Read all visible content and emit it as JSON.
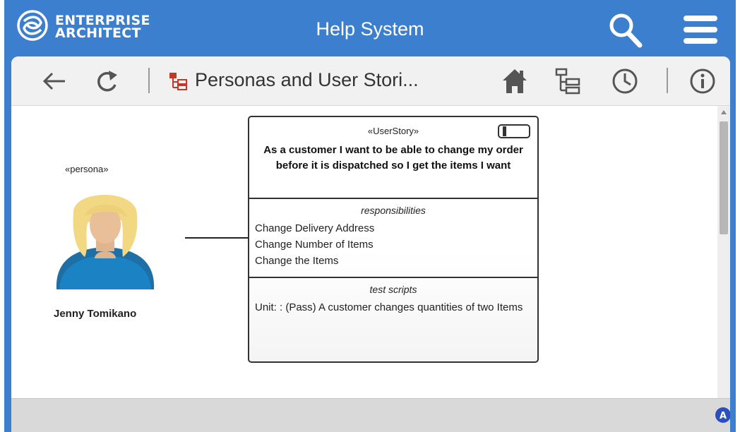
{
  "window": {
    "logo": {
      "icon": "enterprise-architect-logo",
      "line1": "ENTERPRISE",
      "line2": "ARCHITECT"
    },
    "title": "Help System",
    "search_icon": "search-icon",
    "menu_icon": "hamburger-menu-icon"
  },
  "toolbar": {
    "back_icon": "back-arrow-icon",
    "refresh_icon": "refresh-icon",
    "page_icon": "diagram-icon",
    "page_title": "Personas and User Stori...",
    "home_icon": "home-icon",
    "tree_icon": "tree-view-icon",
    "history_icon": "history-clock-icon",
    "info_icon": "info-icon"
  },
  "diagram": {
    "persona": {
      "stereotype": "«persona»",
      "name": "Jenny Tomikano",
      "icon": "persona-woman-icon"
    },
    "user_story": {
      "stereotype": "«UserStory»",
      "title": "As a customer I want to be able to change my order before it is dispatched so I get the items I want",
      "responsibilities_heading": "responsibilities",
      "responsibilities": [
        "Change Delivery Address",
        "Change Number of Items",
        "Change the Items"
      ],
      "test_scripts_heading": "test scripts",
      "test_scripts": [
        "Unit: : (Pass) A customer changes quantities of two Items"
      ]
    }
  },
  "statusbar": {
    "icon": "status-a-icon"
  },
  "colors": {
    "brand_blue": "#3c7fcf",
    "toolbar_bg": "#f1f1f1",
    "statusbar_bg": "#d9d9d9",
    "diagram_icon_red": "#c0392b"
  }
}
